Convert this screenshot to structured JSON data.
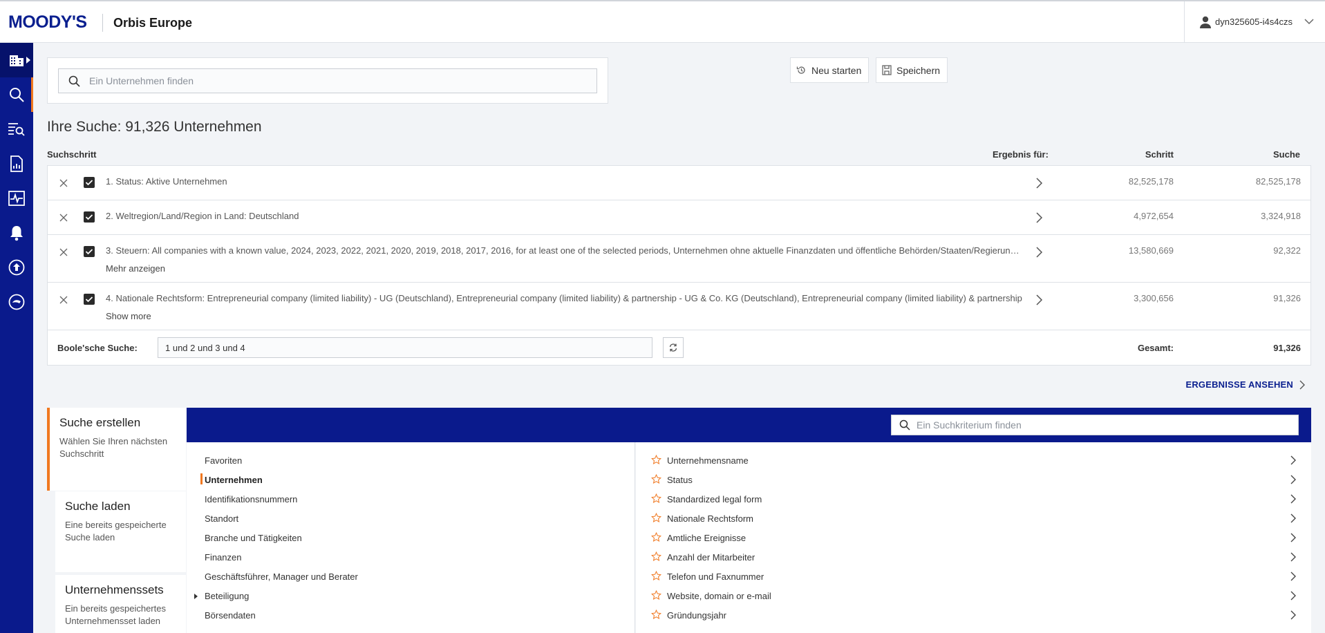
{
  "header": {
    "logo": "MOODY'S",
    "product": "Orbis Europe",
    "username": "dyn325605-i4s4czs"
  },
  "search": {
    "placeholder": "Ein Unternehmen finden"
  },
  "toolbar": {
    "restart_label": "Neu starten",
    "save_label": "Speichern"
  },
  "result_title": "Ihre Suche: 91,326 Unternehmen",
  "table": {
    "col_step": "Suchschritt",
    "col_result_for": "Ergebnis für:",
    "col_step_count": "Schritt",
    "col_search_count": "Suche"
  },
  "steps": [
    {
      "text": "1. Status: Aktive Unternehmen",
      "more": "",
      "step_count": "82,525,178",
      "search_count": "82,525,178"
    },
    {
      "text": "2. Weltregion/Land/Region in Land: Deutschland",
      "more": "",
      "step_count": "4,972,654",
      "search_count": "3,324,918"
    },
    {
      "text": "3. Steuern: All companies with a known value, 2024, 2023, 2022, 2021, 2020, 2019, 2018, 2017, 2016, for at least one of the selected periods, Unternehmen ohne aktuelle Finanzdaten und öffentliche Behörden/Staaten/Regierungen",
      "more": "Mehr anzeigen",
      "step_count": "13,580,669",
      "search_count": "92,322"
    },
    {
      "text": "4. Nationale Rechtsform: Entrepreneurial company (limited liability) - UG (Deutschland), Entrepreneurial company (limited liability) & partnership - UG & Co. KG (Deutschland), Entrepreneurial company (limited liability) & partnership",
      "more": "Show more",
      "step_count": "3,300,656",
      "search_count": "91,326"
    }
  ],
  "boolean": {
    "label": "Boole'sche Suche:",
    "value": "1 und 2 und 3 und 4",
    "total_label": "Gesamt:",
    "total_value": "91,326"
  },
  "results_link": "ERGEBNISSE ANSEHEN",
  "left_tabs": [
    {
      "title": "Suche erstellen",
      "desc": "Wählen Sie Ihren nächsten Suchschritt"
    },
    {
      "title": "Suche laden",
      "desc": "Eine bereits gespeicherte Suche laden"
    },
    {
      "title": "Unternehmenssets",
      "desc": "Ein bereits gespeichertes Unternehmensset laden"
    }
  ],
  "criteria_search": {
    "placeholder": "Ein Suchkriterium finden"
  },
  "categories": [
    "Favoriten",
    "Unternehmen",
    "Identifikationsnummern",
    "Standort",
    "Branche und Tätigkeiten",
    "Finanzen",
    "Geschäftsführer, Manager und Berater",
    "Beteiligung",
    "Börsendaten"
  ],
  "criteria": [
    "Unternehmensname",
    "Status",
    "Standardized legal form",
    "Nationale Rechtsform",
    "Amtliche Ereignisse",
    "Anzahl der Mitarbeiter",
    "Telefon und Faxnummer",
    "Website, domain or e-mail",
    "Gründungsjahr"
  ],
  "colors": {
    "brand_navy": "#0a1a8c",
    "accent_orange": "#f07820",
    "logo_blue": "#0a1f8f"
  }
}
